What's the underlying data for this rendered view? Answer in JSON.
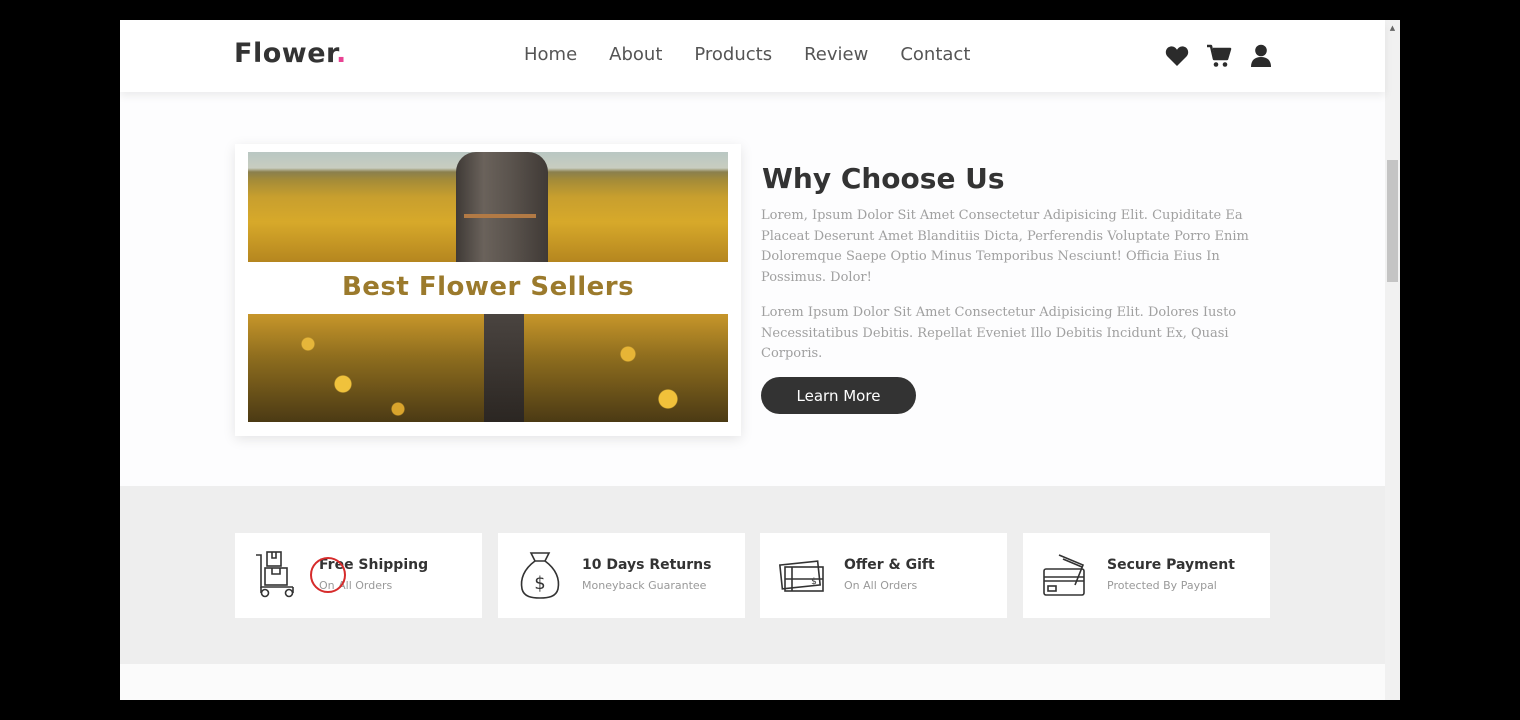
{
  "header": {
    "logo_text": "Flower",
    "logo_dot": ".",
    "nav": [
      "Home",
      "About",
      "Products",
      "Review",
      "Contact"
    ],
    "icons": [
      "heart-icon",
      "shopping-cart-icon",
      "user-icon"
    ]
  },
  "about": {
    "image_caption": "Best Flower Sellers",
    "title": "Why Choose Us",
    "paragraph1": "Lorem, Ipsum Dolor Sit Amet Consectetur Adipisicing Elit. Cupiditate Ea Placeat Deserunt Amet Blanditiis Dicta, Perferendis Voluptate Porro Enim Doloremque Saepe Optio Minus Temporibus Nesciunt! Officia Eius In Possimus. Dolor!",
    "paragraph2": "Lorem Ipsum Dolor Sit Amet Consectetur Adipisicing Elit. Dolores Iusto Necessitatibus Debitis. Repellat Eveniet Illo Debitis Incidunt Ex, Quasi Corporis.",
    "button": "Learn More"
  },
  "features": [
    {
      "title": "Free Shipping",
      "subtitle": "On All Orders",
      "icon": "delivery-cart-icon"
    },
    {
      "title": "10 Days Returns",
      "subtitle": "Moneyback Guarantee",
      "icon": "money-bag-icon"
    },
    {
      "title": "Offer & Gift",
      "subtitle": "On All Orders",
      "icon": "gift-card-icon"
    },
    {
      "title": "Secure Payment",
      "subtitle": "Protected By Paypal",
      "icon": "credit-card-icon"
    }
  ],
  "colors": {
    "accent": "#e84393",
    "dark": "#333333",
    "click_marker": "#d62b2b"
  }
}
